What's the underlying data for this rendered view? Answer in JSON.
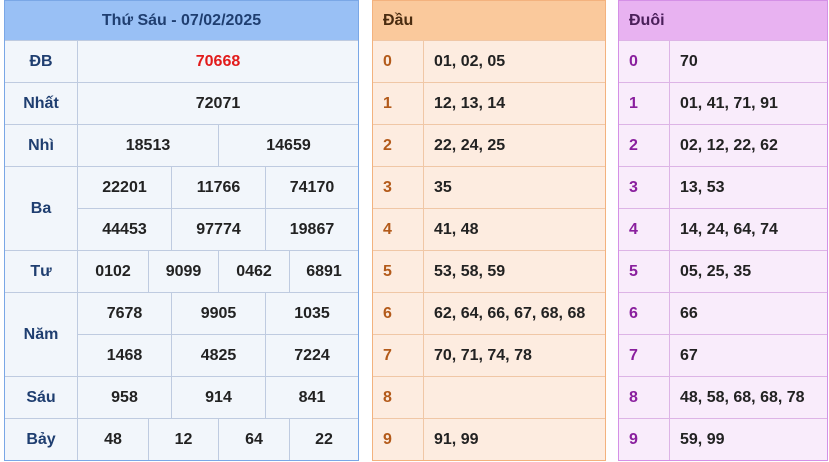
{
  "main": {
    "title": "Thứ Sáu - 07/02/2025",
    "rows": [
      {
        "label": "ĐB",
        "values": [
          "70668"
        ]
      },
      {
        "label": "Nhất",
        "values": [
          "72071"
        ]
      },
      {
        "label": "Nhì",
        "values": [
          "18513",
          "14659"
        ]
      },
      {
        "label": "Ba",
        "values": [
          "22201",
          "11766",
          "74170",
          "44453",
          "97774",
          "19867"
        ]
      },
      {
        "label": "Tư",
        "values": [
          "0102",
          "9099",
          "0462",
          "6891"
        ]
      },
      {
        "label": "Năm",
        "values": [
          "7678",
          "9905",
          "1035",
          "1468",
          "4825",
          "7224"
        ]
      },
      {
        "label": "Sáu",
        "values": [
          "958",
          "914",
          "841"
        ]
      },
      {
        "label": "Bảy",
        "values": [
          "48",
          "12",
          "64",
          "22"
        ]
      }
    ]
  },
  "dau": {
    "title": "Đầu",
    "rows": [
      {
        "digit": "0",
        "list": "01, 02, 05"
      },
      {
        "digit": "1",
        "list": "12, 13, 14"
      },
      {
        "digit": "2",
        "list": "22, 24, 25"
      },
      {
        "digit": "3",
        "list": "35"
      },
      {
        "digit": "4",
        "list": "41, 48"
      },
      {
        "digit": "5",
        "list": "53, 58, 59"
      },
      {
        "digit": "6",
        "list": "62, 64, 66, 67, 68, 68"
      },
      {
        "digit": "7",
        "list": "70, 71, 74, 78"
      },
      {
        "digit": "8",
        "list": ""
      },
      {
        "digit": "9",
        "list": "91, 99"
      }
    ]
  },
  "duoi": {
    "title": "Đuôi",
    "rows": [
      {
        "digit": "0",
        "list": "70"
      },
      {
        "digit": "1",
        "list": "01, 41, 71, 91"
      },
      {
        "digit": "2",
        "list": "02, 12, 22, 62"
      },
      {
        "digit": "3",
        "list": "13, 53"
      },
      {
        "digit": "4",
        "list": "14, 24, 64, 74"
      },
      {
        "digit": "5",
        "list": "05, 25, 35"
      },
      {
        "digit": "6",
        "list": "66"
      },
      {
        "digit": "7",
        "list": "67"
      },
      {
        "digit": "8",
        "list": "48, 58, 68, 68, 78"
      },
      {
        "digit": "9",
        "list": "59, 99"
      }
    ]
  }
}
